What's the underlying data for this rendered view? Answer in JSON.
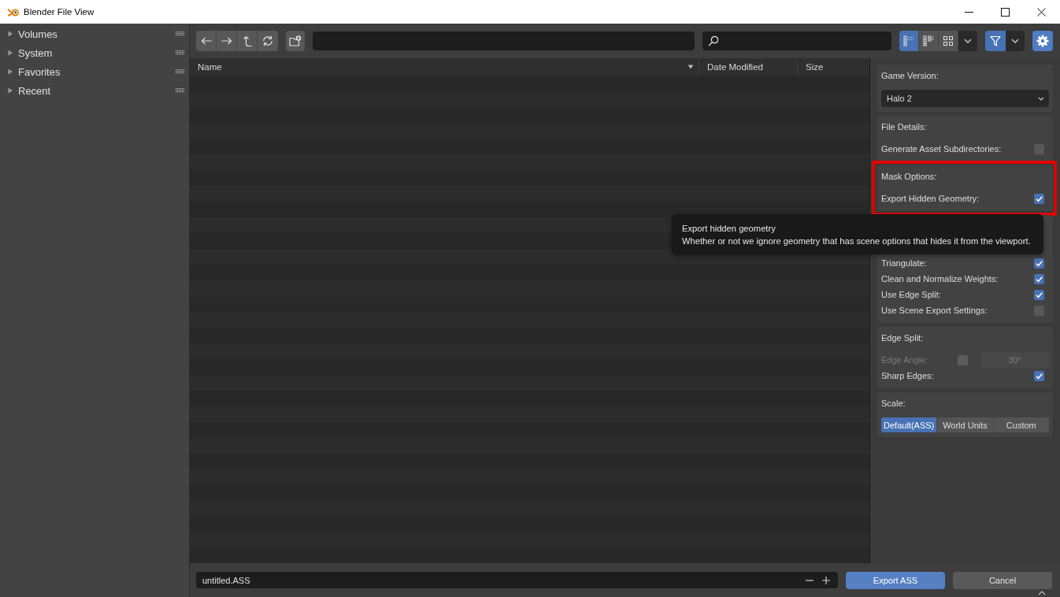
{
  "window": {
    "title": "Blender File View"
  },
  "sidebar": {
    "items": [
      {
        "label": "Volumes",
        "expanded": false
      },
      {
        "label": "System",
        "expanded": false
      },
      {
        "label": "Favorites",
        "expanded": false
      },
      {
        "label": "Recent",
        "expanded": false
      }
    ]
  },
  "toolbar": {
    "view_modes": [
      {
        "kind": "vertical",
        "selected": true
      },
      {
        "kind": "horizontal",
        "selected": false
      },
      {
        "kind": "thumbnails",
        "selected": false
      }
    ],
    "filter_on": true,
    "settings_on": true
  },
  "file_list": {
    "columns": [
      {
        "label": "Name",
        "sorted": true
      },
      {
        "label": "Date Modified",
        "sorted": false
      },
      {
        "label": "Size",
        "sorted": false
      }
    ]
  },
  "panels": [
    {
      "title": "Game Version:",
      "highlighted": false,
      "rows": [
        {
          "kind": "dropdown",
          "value": "Halo 2"
        }
      ]
    },
    {
      "title": "File Details:",
      "highlighted": false,
      "rows": [
        {
          "kind": "checkbox",
          "label": "Generate Asset Subdirectories:",
          "checked": false,
          "disabled": false
        }
      ]
    },
    {
      "title": "Mask Options:",
      "highlighted": true,
      "rows": [
        {
          "kind": "checkbox",
          "label": "Export Hidden Geometry:",
          "checked": true,
          "disabled": false
        }
      ]
    },
    {
      "highlighted": false,
      "rows": [
        {
          "kind": "checkbox",
          "label": "Triangulate:",
          "checked": true,
          "disabled": false
        },
        {
          "kind": "checkbox",
          "label": "Clean and Normalize Weights:",
          "checked": true,
          "disabled": false
        },
        {
          "kind": "checkbox",
          "label": "Use Edge Split:",
          "checked": true,
          "disabled": false
        },
        {
          "kind": "checkbox",
          "label": "Use Scene Export Settings:",
          "checked": false,
          "disabled": false
        }
      ]
    },
    {
      "title": "Edge Split:",
      "highlighted": false,
      "rows": [
        {
          "kind": "angle",
          "label": "Edge Angle:",
          "checked": false,
          "disabled": true,
          "value": "30°"
        },
        {
          "kind": "checkbox",
          "label": "Sharp Edges:",
          "checked": true,
          "disabled": false
        }
      ]
    },
    {
      "title": "Scale:",
      "highlighted": false,
      "rows": [
        {
          "kind": "segmented",
          "options": [
            {
              "label": "Default(ASS)",
              "selected": true
            },
            {
              "label": "World Units",
              "selected": false
            },
            {
              "label": "Custom",
              "selected": false
            }
          ]
        }
      ]
    }
  ],
  "tooltip": {
    "title": "Export hidden geometry",
    "description": "Whether or not we ignore geometry that has scene options that hides it from the viewport."
  },
  "footer": {
    "filename": "untitled.ASS",
    "buttons": [
      {
        "label": "Export ASS",
        "kind": "primary"
      },
      {
        "label": "Cancel",
        "kind": "secondary"
      }
    ]
  }
}
